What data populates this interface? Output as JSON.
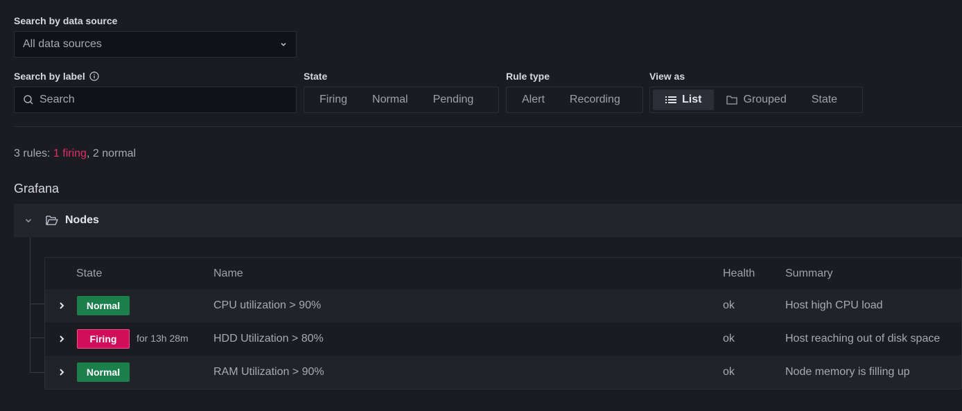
{
  "filters": {
    "datasource_label": "Search by data source",
    "datasource_value": "All data sources",
    "label_search_label": "Search by label",
    "label_search_placeholder": "Search",
    "state_label": "State",
    "state_options": [
      "Firing",
      "Normal",
      "Pending"
    ],
    "rule_type_label": "Rule type",
    "rule_type_options": [
      "Alert",
      "Recording"
    ],
    "view_as_label": "View as",
    "view_as_options": [
      "List",
      "Grouped",
      "State"
    ],
    "view_as_selected": "List"
  },
  "summary": {
    "prefix": "3 rules: ",
    "firing": "1 firing",
    "sep": ", ",
    "normal": "2 normal"
  },
  "section": {
    "title": "Grafana",
    "folder": "Nodes"
  },
  "table": {
    "headers": {
      "state": "State",
      "name": "Name",
      "health": "Health",
      "summary": "Summary"
    },
    "rows": [
      {
        "state": "Normal",
        "for": "",
        "name": "CPU utilization > 90%",
        "health": "ok",
        "summary": "Host high CPU load"
      },
      {
        "state": "Firing",
        "for": "for 13h 28m",
        "name": "HDD Utilization > 80%",
        "health": "ok",
        "summary": "Host reaching out of disk space"
      },
      {
        "state": "Normal",
        "for": "",
        "name": "RAM Utilization > 90%",
        "health": "ok",
        "summary": "Node memory is filling up"
      }
    ]
  },
  "colors": {
    "firing": "#d10e5c",
    "normal": "#1a7f4b",
    "firing_text": "#e02f64"
  }
}
